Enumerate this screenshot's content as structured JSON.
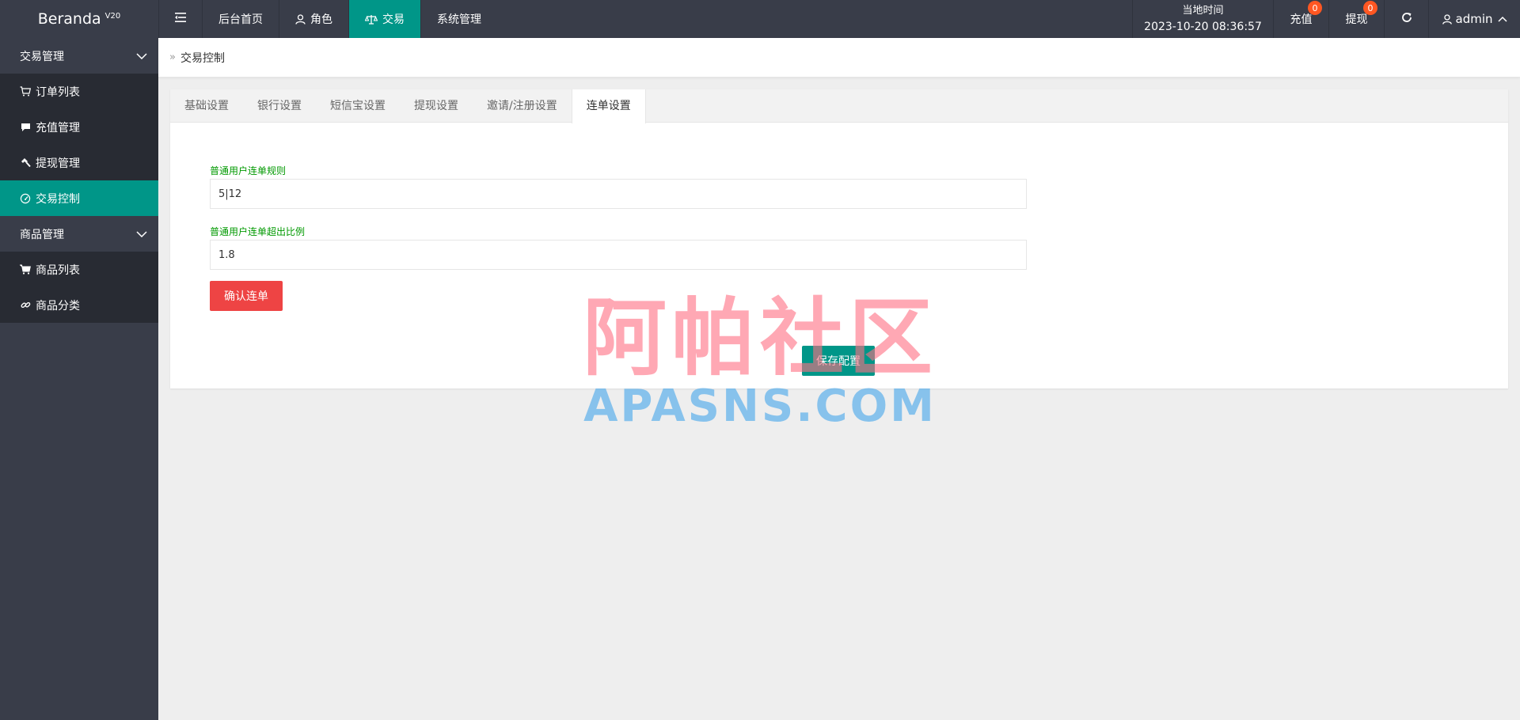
{
  "app": {
    "name": "Beranda",
    "version": "V20"
  },
  "topnav": {
    "items": [
      {
        "label": "后台首页",
        "icon": ""
      },
      {
        "label": "角色",
        "icon": "user-icon"
      },
      {
        "label": "交易",
        "icon": "scale-icon",
        "active": true
      },
      {
        "label": "系统管理",
        "icon": ""
      }
    ],
    "time_label": "当地时间",
    "time_value": "2023-10-20 08:36:57",
    "recharge_label": "充值",
    "recharge_count": "0",
    "withdraw_label": "提现",
    "withdraw_count": "0",
    "user": "admin"
  },
  "sidebar": {
    "groups": [
      {
        "label": "交易管理",
        "items": [
          {
            "label": "订单列表",
            "icon": "cart-icon"
          },
          {
            "label": "充值管理",
            "icon": "chat-icon"
          },
          {
            "label": "提现管理",
            "icon": "hammer-icon"
          },
          {
            "label": "交易控制",
            "icon": "dashboard-icon",
            "active": true
          }
        ]
      },
      {
        "label": "商品管理",
        "items": [
          {
            "label": "商品列表",
            "icon": "cart-icon"
          },
          {
            "label": "商品分类",
            "icon": "link-icon"
          }
        ]
      }
    ]
  },
  "breadcrumb": {
    "current": "交易控制"
  },
  "tabs": [
    "基础设置",
    "银行设置",
    "短信宝设置",
    "提现设置",
    "邀请/注册设置",
    "连单设置"
  ],
  "active_tab": 5,
  "form": {
    "rule_label": "普通用户连单规则",
    "rule_value": "5|12",
    "ratio_label": "普通用户连单超出比例",
    "ratio_value": "1.8",
    "confirm_label": "确认连单",
    "save_label": "保存配置"
  },
  "watermark": {
    "cn": "阿帕社区",
    "en": "APASNS.COM"
  },
  "colors": {
    "topbar": "#393d49",
    "accent": "#009688",
    "danger": "#ee4444",
    "badge": "#ff5722",
    "label_green": "#009900"
  }
}
